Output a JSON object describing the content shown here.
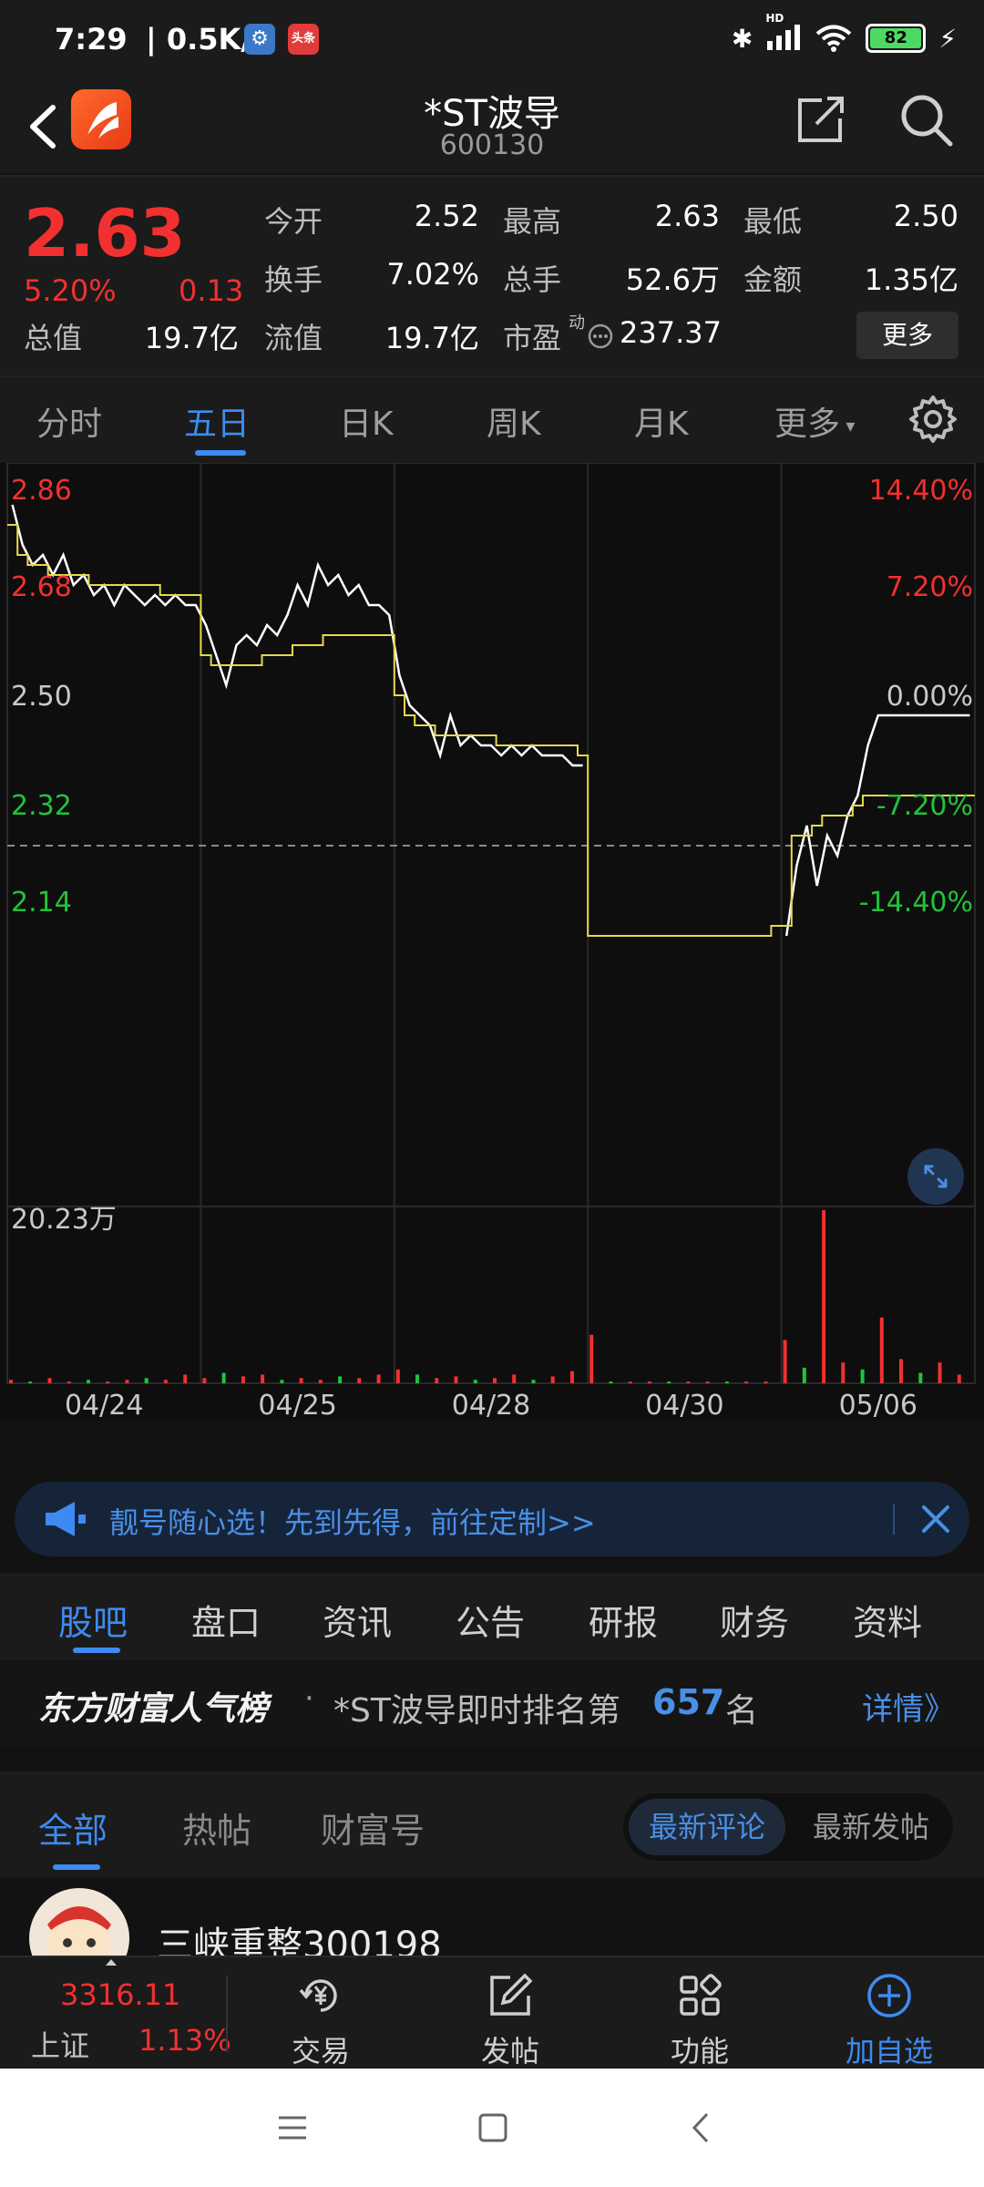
{
  "status_bar": {
    "time": "7:29",
    "speed": "| 0.5K/s",
    "toutiao_badge": "头条",
    "network": "HD",
    "battery": "82"
  },
  "header": {
    "title": "*ST波导",
    "code": "600130"
  },
  "quote": {
    "price": "2.63",
    "change_pct": "5.20%",
    "change_amt": "0.13",
    "total_mv_label": "总值",
    "total_mv": "19.7亿",
    "open_label": "今开",
    "open": "2.52",
    "high_label": "最高",
    "high": "2.63",
    "low_label": "最低",
    "low": "2.50",
    "turnover_label": "换手",
    "turnover": "7.02%",
    "volume_label": "总手",
    "volume": "52.6万",
    "amount_label": "金额",
    "amount": "1.35亿",
    "float_mv_label": "流值",
    "float_mv": "19.7亿",
    "pe_label": "市盈",
    "pe_sup": "动",
    "pe": "237.37",
    "more": "更多"
  },
  "chart_tabs": [
    "分时",
    "五日",
    "日K",
    "周K",
    "月K",
    "更多"
  ],
  "chart_tab_active": 1,
  "chart_data": {
    "type": "line",
    "y_labels_left": [
      "2.86",
      "2.68",
      "2.50",
      "2.32",
      "2.14"
    ],
    "y_labels_right": [
      "14.40%",
      "7.20%",
      "0.00%",
      "-7.20%",
      "-14.40%"
    ],
    "ylim": [
      2.14,
      2.86
    ],
    "prev_close": 2.5,
    "x_labels": [
      "04/24",
      "04/25",
      "04/28",
      "04/30",
      "05/06"
    ],
    "volume_max_label": "20.23万",
    "colors": {
      "up": "#f23030",
      "down": "#23c23c",
      "price": "#ffffff",
      "avg": "#e6d84a",
      "flat": "#c8c8c8"
    },
    "series": [
      {
        "values": [
          2.84,
          2.8,
          2.78,
          2.79,
          2.77,
          2.79,
          2.76,
          2.77,
          2.75,
          2.76,
          2.74,
          2.76,
          2.75,
          2.74,
          2.75,
          2.74,
          2.75,
          2.74,
          2.74,
          2.72,
          2.69,
          2.66,
          2.7,
          2.71,
          2.7,
          2.72,
          2.71,
          2.73,
          2.76,
          2.74,
          2.78,
          2.76,
          2.77,
          2.75,
          2.76,
          2.74,
          2.74,
          2.73,
          2.67,
          2.64,
          2.63,
          2.62,
          2.59,
          2.63,
          2.6,
          2.61,
          2.6,
          2.6,
          2.59,
          2.6,
          2.59,
          2.6,
          2.59,
          2.59,
          2.59,
          2.58,
          2.58,
          null,
          null,
          null,
          null,
          null,
          null,
          null,
          null,
          null,
          null,
          null,
          null,
          null,
          null,
          null,
          null,
          null,
          null,
          null,
          2.41,
          2.48,
          2.52,
          2.46,
          2.51,
          2.49,
          2.53,
          2.55,
          2.6,
          2.63,
          2.63,
          2.63,
          2.63,
          2.63,
          2.63,
          2.63,
          2.63,
          2.63,
          2.63
        ]
      },
      {
        "values": [
          2.82,
          2.79,
          2.78,
          2.78,
          2.77,
          2.77,
          2.77,
          2.77,
          2.76,
          2.76,
          2.76,
          2.76,
          2.76,
          2.76,
          2.76,
          2.75,
          2.75,
          2.75,
          2.75,
          2.69,
          2.68,
          2.68,
          2.68,
          2.68,
          2.68,
          2.69,
          2.69,
          2.69,
          2.7,
          2.7,
          2.7,
          2.71,
          2.71,
          2.71,
          2.71,
          2.71,
          2.71,
          2.71,
          2.65,
          2.63,
          2.62,
          2.62,
          2.61,
          2.61,
          2.61,
          2.61,
          2.61,
          2.61,
          2.6,
          2.6,
          2.6,
          2.6,
          2.6,
          2.6,
          2.6,
          2.6,
          2.59,
          2.41,
          2.41,
          2.41,
          2.41,
          2.41,
          2.41,
          2.41,
          2.41,
          2.41,
          2.41,
          2.41,
          2.41,
          2.41,
          2.41,
          2.41,
          2.41,
          2.41,
          2.41,
          2.42,
          2.42,
          2.51,
          2.51,
          2.52,
          2.53,
          2.53,
          2.53,
          2.54,
          2.55,
          2.55,
          2.55,
          2.55,
          2.55,
          2.55,
          2.55,
          2.55,
          2.55,
          2.55,
          2.55
        ]
      }
    ],
    "volume": [
      {
        "day": 0,
        "values": [
          0.02,
          0.01,
          0.03,
          0.01,
          0.02,
          0.01,
          0.02,
          0.03,
          0.02,
          0.05
        ]
      },
      {
        "day": 1,
        "values": [
          0.03,
          0.06,
          0.04,
          0.05,
          0.02,
          0.03,
          0.02,
          0.04,
          0.03,
          0.05
        ]
      },
      {
        "day": 2,
        "values": [
          0.08,
          0.05,
          0.03,
          0.04,
          0.02,
          0.03,
          0.05,
          0.02,
          0.04,
          0.07
        ]
      },
      {
        "day": 3,
        "values": [
          0.28,
          0.01,
          0.01,
          0.01,
          0.01,
          0.01,
          0.01,
          0.01,
          0.01,
          0.01
        ]
      },
      {
        "day": 4,
        "values": [
          0.25,
          0.09,
          1.0,
          0.12,
          0.08,
          0.38,
          0.14,
          0.06,
          0.12,
          0.05
        ]
      }
    ],
    "grid": true
  },
  "banner": {
    "text": "靓号随心选！先到先得，前往定制>>"
  },
  "info_tabs": [
    "股吧",
    "盘口",
    "资讯",
    "公告",
    "研报",
    "财务",
    "资料"
  ],
  "ranking": {
    "brand": "东方财富人气榜",
    "dot": "·",
    "text_pre": "*ST波导即时排名第",
    "rank": "657",
    "text_post": "名",
    "detail": "详情》"
  },
  "feed": {
    "tabs": [
      "全部",
      "热帖",
      "财富号"
    ],
    "sort_latest_comment": "最新评论",
    "sort_latest_post": "最新发帖",
    "post_author": "三峡重整300198"
  },
  "bottom_bar": {
    "index_value": "3316.11",
    "index_name": "上证",
    "index_pct": "1.13%",
    "items": [
      "交易",
      "发帖",
      "功能",
      "加自选"
    ]
  }
}
